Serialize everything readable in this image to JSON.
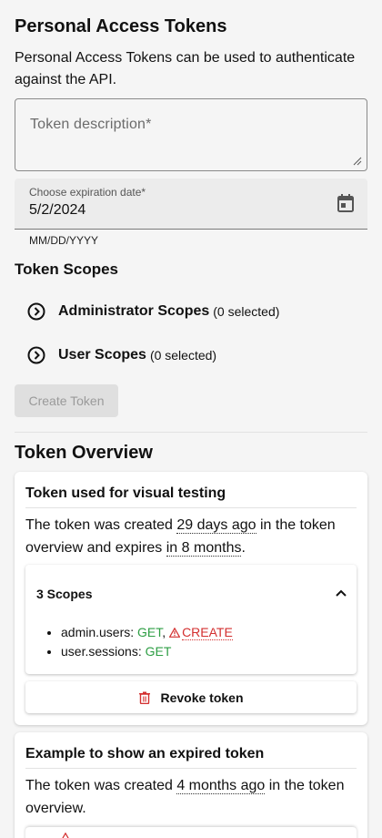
{
  "header": {
    "title": "Personal Access Tokens",
    "intro": "Personal Access Tokens can be used to authenticate against the API."
  },
  "form": {
    "description_placeholder": "Token description*",
    "expiration_label": "Choose expiration date*",
    "expiration_value": "5/2/2024",
    "expiration_hint": "MM/DD/YYYY",
    "scopes_title": "Token Scopes",
    "scope_groups": [
      {
        "label": "Administrator Scopes",
        "count": "(0 selected)"
      },
      {
        "label": "User Scopes",
        "count": "(0 selected)"
      }
    ],
    "create_label": "Create Token"
  },
  "overview": {
    "title": "Token Overview",
    "tokens": [
      {
        "name": "Token used for visual testing",
        "created_prefix": "The token was created",
        "created_rel": "29 days ago",
        "middle": "in the token overview and expires",
        "expires_rel": "in 8 months",
        "end": ".",
        "scopes_header": "3 Scopes",
        "scopes": [
          {
            "name": "admin.users:",
            "get": "GET",
            "sep": ",",
            "create": "CREATE"
          },
          {
            "name": "user.sessions:",
            "get": "GET"
          }
        ],
        "revoke_label": "Revoke token"
      },
      {
        "name": "Example to show an expired token",
        "created_prefix": "The token was created",
        "created_rel": "4 months ago",
        "end": "in the token overview."
      }
    ]
  },
  "colors": {
    "get": "#2e9e44",
    "create": "#d32f2f",
    "revoke_icon": "#d32f2f"
  }
}
